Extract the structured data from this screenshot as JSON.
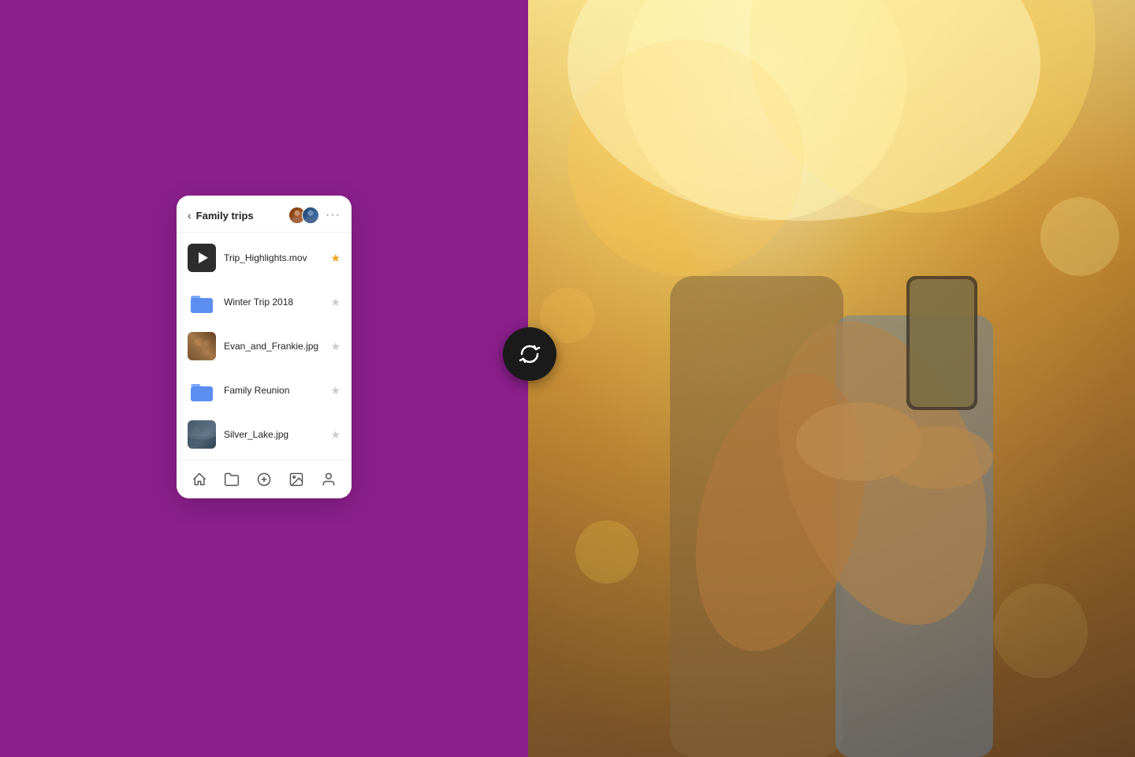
{
  "left": {
    "bg_color": "#8B1F8B"
  },
  "card": {
    "header": {
      "back_label": "<",
      "title": "Family trips",
      "more_label": "···"
    },
    "files": [
      {
        "name": "Trip_Highlights.mov",
        "type": "video",
        "starred": true
      },
      {
        "name": "Winter Trip 2018",
        "type": "folder",
        "starred": false
      },
      {
        "name": "Evan_and_Frankie.jpg",
        "type": "image-warm",
        "starred": false
      },
      {
        "name": "Family Reunion",
        "type": "folder",
        "starred": false
      },
      {
        "name": "Silver_Lake.jpg",
        "type": "image-cool",
        "starred": false
      }
    ],
    "nav": {
      "home_label": "home",
      "folder_label": "folder",
      "add_label": "add",
      "photo_label": "photo",
      "person_label": "person"
    }
  },
  "sync_button": {
    "label": "sync"
  }
}
